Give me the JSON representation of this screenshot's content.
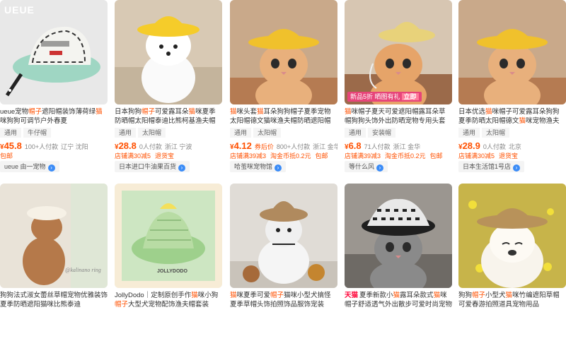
{
  "products": [
    {
      "title_pre": "ueue宠物",
      "title_hl1": "帽子",
      "title_mid": "遮阳帽装饰薄荷绿",
      "title_hl2": "猫",
      "title_post": "咪狗狗可调节户外春夏",
      "tags": [
        "通用",
        "牛仔帽"
      ],
      "price": "45.8",
      "meta": "100+人付款",
      "location": "辽宁 沈阳",
      "badges": [
        "包邮"
      ],
      "shop": "ueue 由一宠物",
      "brandmark": "UEUE",
      "img_bg": "#e8e8e8",
      "subject": "cap"
    },
    {
      "title_pre": "日本狗狗",
      "title_hl1": "帽子",
      "title_mid": "可爱露耳朵",
      "title_hl2": "猫",
      "title_post": "咪夏季防晒帽太阳帽泰迪比熊柯基渔夫帽",
      "tags": [
        "通用",
        "太阳帽"
      ],
      "price": "28.8",
      "meta": "0人付款",
      "location": "浙江 宁波",
      "badges": [
        "店铺满30减5",
        "退货宝"
      ],
      "shop": "日本进口牛油果百货",
      "img_bg": "#d8c9b4",
      "subject": "dog"
    },
    {
      "title_pre": "",
      "title_hl1": "猫",
      "title_mid": "咪头套",
      "title_hl2": "猫",
      "title_post": "耳朵狗狗帽子夏季宠物太阳帽德文猫咪渔夫帽防晒遮阳帽",
      "tags": [
        "通用",
        "太阳帽"
      ],
      "price": "4.12",
      "after": "券后价",
      "meta": "800+人付款",
      "location": "浙江 金华",
      "badges": [
        "店铺满39减3",
        "淘金币抵0.2元",
        "包邮"
      ],
      "shop": "哈茧咪宠物馆",
      "img_bg": "#c9a98a",
      "subject": "cat1"
    },
    {
      "title_pre": "",
      "title_hl1": "猫",
      "title_mid": "咪帽子夏天可爱遮阳帽露耳朵草帽狗狗头饰外出防晒宠物专用头套",
      "title_hl2": "",
      "title_post": "",
      "tags": [
        "通用",
        "安装帽"
      ],
      "price": "6.8",
      "meta": "71人付款",
      "location": "浙江 金华",
      "badges": [
        "店铺满39减3",
        "淘金币抵0.2元",
        "包邮"
      ],
      "shop": "等什么风",
      "promo": "新品5折 晒图有礼",
      "promo_btn": "立即",
      "img_bg": "#c99a78",
      "subject": "cat2"
    },
    {
      "title_pre": "日本优选",
      "title_hl1": "猫",
      "title_mid": "咪帽子可爱露耳朵狗狗夏季防晒太阳帽德文",
      "title_hl2": "猫",
      "title_post": "咪宠物渔夫帽",
      "tags": [
        "通用",
        "太阳帽"
      ],
      "price": "28.9",
      "meta": "0人付款",
      "location": "北京",
      "badges": [
        "店铺满30减5",
        "退货宝"
      ],
      "shop": "日本生活馆1号店",
      "img_bg": "#c9a98a",
      "subject": "cat3"
    },
    {
      "title_pre": "狗狗法式淑女蕾丝草帽宠物优雅装饰夏季防晒遮阳猫咪比熊泰迪",
      "title_hl1": "",
      "title_mid": "",
      "title_hl2": "",
      "title_post": "",
      "tags": [],
      "price": "",
      "meta": "",
      "location": "",
      "badges": [],
      "shop": "",
      "watermark": "@kalinano ring",
      "img_bg": "#e9e3d8",
      "subject": "poodle"
    },
    {
      "title_pre": "JollyDodo｜定制原创手作",
      "title_hl1": "猫",
      "title_mid": "咪小狗",
      "title_hl2": "帽子",
      "title_post": "大型犬宠物配饰渔夫帽套装",
      "tags": [],
      "price": "",
      "meta": "",
      "location": "",
      "badges": [],
      "shop": "",
      "img_bg": "#f2e4c9",
      "subject": "hat"
    },
    {
      "title_pre": "",
      "title_hl1": "猫",
      "title_mid": "咪夏季可爱",
      "title_hl2": "帽子",
      "title_post": "猫咪小型犬搞怪夏季草帽头饰拍照饰品服饰宠装",
      "tags": [],
      "price": "",
      "meta": "",
      "location": "",
      "badges": [],
      "shop": "",
      "img_bg": "#e0dcd6",
      "subject": "cat4"
    },
    {
      "tmall": "天猫",
      "title_pre": "夏季新款小",
      "title_hl1": "猫",
      "title_mid": "露耳朵款式",
      "title_hl2": "猫",
      "title_post": "咪帽子舒适透气外出散步可爱时尚宠物帽",
      "tags": [],
      "price": "",
      "meta": "",
      "location": "",
      "badges": [],
      "shop": "",
      "img_bg": "#9b9690",
      "subject": "cat5"
    },
    {
      "title_pre": "狗狗",
      "title_hl1": "帽子",
      "title_mid": "小型犬",
      "title_hl2": "猫",
      "title_post": "咪竹编遮阳草帽可爱春游拍照道具宠物用品",
      "tags": [],
      "price": "",
      "meta": "",
      "location": "",
      "badges": [],
      "shop": "",
      "img_bg": "#d9c24a",
      "subject": "shiba"
    }
  ]
}
